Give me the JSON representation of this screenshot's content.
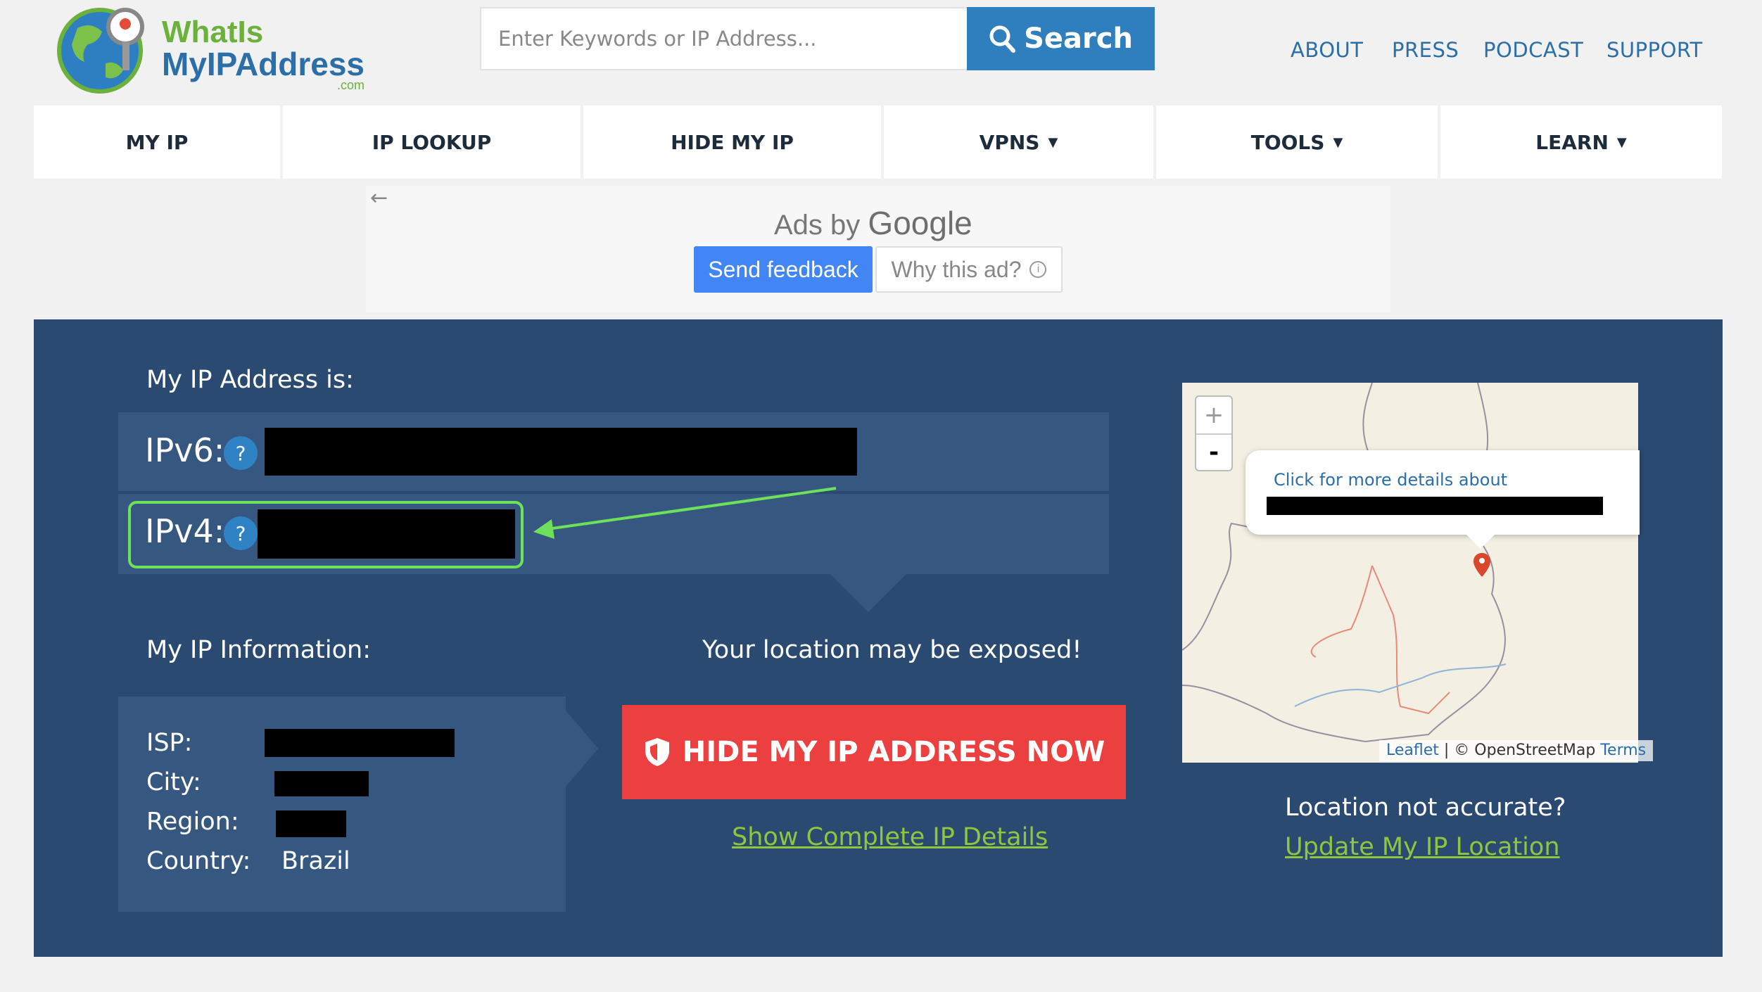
{
  "header": {
    "logo_line1": "WhatIs",
    "logo_line2": "MyIPAddress",
    "logo_suffix": ".com",
    "search_placeholder": "Enter Keywords or IP Address...",
    "search_label": "Search",
    "top_links": [
      "ABOUT",
      "PRESS",
      "PODCAST",
      "SUPPORT"
    ]
  },
  "nav": {
    "items": [
      {
        "label": "MY IP",
        "caret": ""
      },
      {
        "label": "IP LOOKUP",
        "caret": ""
      },
      {
        "label": "HIDE MY IP",
        "caret": ""
      },
      {
        "label": "VPNS",
        "caret": "▼"
      },
      {
        "label": "TOOLS",
        "caret": "▼"
      },
      {
        "label": "LEARN",
        "caret": "▼"
      }
    ]
  },
  "ad": {
    "ads_by": "Ads by",
    "google": "Google",
    "send_feedback": "Send feedback",
    "why_ad": "Why this ad?"
  },
  "main": {
    "my_ip_heading": "My IP Address is:",
    "ipv6_label": "IPv6:",
    "ipv4_label": "IPv4:",
    "help_glyph": "?",
    "info_heading": "My IP Information:",
    "location_warning": "Your location may be exposed!",
    "info": [
      {
        "label": "ISP:",
        "value": ""
      },
      {
        "label": "City:",
        "value": ""
      },
      {
        "label": "Region:",
        "value": ""
      },
      {
        "label": "Country:",
        "value": "Brazil"
      }
    ],
    "hide_button": "HIDE MY IP ADDRESS NOW",
    "show_details": "Show Complete IP Details"
  },
  "map": {
    "zoom_in": "+",
    "zoom_out": "-",
    "popup_text": "Click for more details about",
    "attribution_leaflet": "Leaflet",
    "attribution_sep": " | © OpenStreetMap ",
    "attribution_terms": "Terms",
    "not_accurate": "Location not accurate?",
    "update_link": "Update My IP Location"
  },
  "colors": {
    "panel": "#2b4a72",
    "accent_blue": "#2f7fbf",
    "danger": "#ec3f3f",
    "link_green": "#8ec63f",
    "highlight": "#6ee05a"
  }
}
